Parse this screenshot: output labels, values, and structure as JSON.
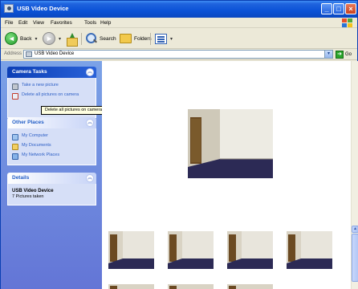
{
  "window": {
    "title": "USB Video Device",
    "controls": {
      "minimize": "_",
      "maximize": "□",
      "close": "×"
    }
  },
  "menubar": {
    "items": [
      "File",
      "Edit",
      "View",
      "Favorites",
      "Tools",
      "Help"
    ]
  },
  "toolbar": {
    "back_label": "Back",
    "search_label": "Search",
    "folders_label": "Folders",
    "icons": [
      "back-arrow-icon",
      "forward-arrow-icon",
      "up-folder-icon",
      "search-icon",
      "folders-icon",
      "views-icon"
    ]
  },
  "addressbar": {
    "label": "Address",
    "value": "USB Video Device",
    "go_label": "Go"
  },
  "taskpane": {
    "camera_tasks": {
      "title": "Camera Tasks",
      "items": [
        {
          "label": "Take a new picture",
          "icon": "camera-icon"
        },
        {
          "label": "Delete all pictures on camera",
          "icon": "delete-icon"
        }
      ]
    },
    "other_places": {
      "title": "Other Places",
      "items": [
        {
          "label": "My Computer",
          "icon": "computer-icon"
        },
        {
          "label": "My Documents",
          "icon": "documents-folder-icon"
        },
        {
          "label": "My Network Places",
          "icon": "network-icon"
        }
      ]
    },
    "details": {
      "title": "Details",
      "name": "USB Video Device",
      "sub": "7 Pictures taken"
    }
  },
  "tooltip": {
    "text": "Delete all pictures on camera"
  },
  "colors": {
    "titlebar": "#0b52d6",
    "taskpane": "#6f8de0",
    "panel_link": "#2c5ec5",
    "photo_wall": "#e6e3d9",
    "photo_wood": "#6a4a24",
    "photo_floor": "#2c2a55"
  }
}
